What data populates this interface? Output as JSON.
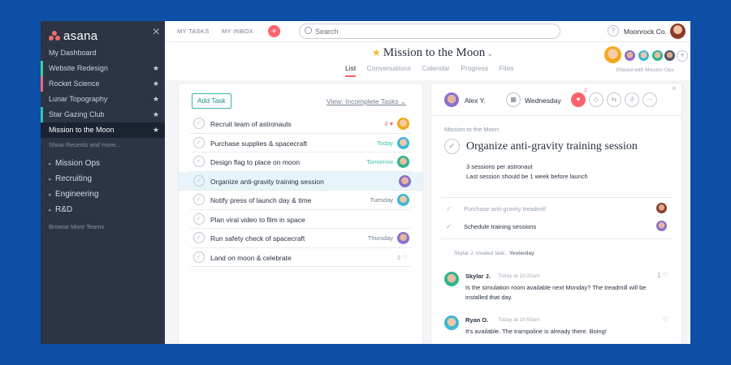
{
  "sidebar": {
    "logo": "asana",
    "close_glyph": "×",
    "dashboard": "My Dashboard",
    "projects": [
      {
        "label": "Website Redesign",
        "color": "#3ecf8e"
      },
      {
        "label": "Rocket Science",
        "color": "#fc636b"
      },
      {
        "label": "Lunar Topography",
        "color": ""
      },
      {
        "label": "Star Gazing Club",
        "color": "#37c5ab"
      },
      {
        "label": "Mission to the Moon",
        "color": "",
        "active": true
      }
    ],
    "show_recents": "Show Recents and more...",
    "teams": [
      "Mission Ops",
      "Recruiting",
      "Engineering",
      "R&D"
    ],
    "browse_teams": "Browse More Teams"
  },
  "topbar": {
    "my_tasks": "MY TASKS",
    "my_inbox": "MY INBOX",
    "add_glyph": "+",
    "search_placeholder": "Search",
    "help_glyph": "?",
    "org_name": "Moonrock Co."
  },
  "project": {
    "title": "Mission to the Moon",
    "tabs": [
      "List",
      "Conversations",
      "Calendar",
      "Progress",
      "Files"
    ],
    "shared_with": "Shared with Mission Ops",
    "add_member_glyph": "+"
  },
  "tasklist": {
    "add_task": "Add Task",
    "view_filter": "View: Incomplete Tasks",
    "tasks": [
      {
        "name": "Recruit team of astronauts",
        "meta": "3 ♥",
        "meta_color": "#fc636b"
      },
      {
        "name": "Purchase supplies & spacecraft",
        "meta": "Today",
        "meta_color": "#37c5ab"
      },
      {
        "name": "Design flag to place on moon",
        "meta": "Tomorrow",
        "meta_color": "#37c5ab"
      },
      {
        "name": "Organize anti-gravity training session",
        "meta": "",
        "meta_color": "#737f8f"
      },
      {
        "name": "Notify press of launch day & time",
        "meta": "Tuesday",
        "meta_color": "#737f8f"
      },
      {
        "name": "Plan viral video to film in space",
        "meta": "",
        "meta_color": "#737f8f"
      },
      {
        "name": "Run safety check of spacecraft",
        "meta": "Thursday",
        "meta_color": "#737f8f"
      },
      {
        "name": "Land on moon & celebrate",
        "meta": "2 ♡",
        "meta_color": "#9aa4b2"
      }
    ]
  },
  "detail": {
    "assignee": "Alex Y.",
    "due": "Wednesday",
    "like_count": "2",
    "project_crumb": "Mission to the Moon",
    "title": "Organize anti-gravity training session",
    "desc_line1": "3 sessions per astronaut",
    "desc_line2": "Last session should be 1 week before launch",
    "subtasks": [
      {
        "name": "Purchase anti-gravity treadmill",
        "done": true
      },
      {
        "name": "Schedule training sessions",
        "done": false
      }
    ],
    "activity_text": "Skylar J. created task.",
    "activity_when": "Yesterday",
    "comments": [
      {
        "author": "Skylar J.",
        "time": "Today at 10:25am",
        "likes": "1 ♡",
        "text": "Is the simulation room available next Monday? The treadmill will be installed that day."
      },
      {
        "author": "Ryan O.",
        "time": "Today at 10:50am",
        "likes": "♡",
        "text": "It's available. The trampoline is already there. Boing!"
      }
    ]
  }
}
